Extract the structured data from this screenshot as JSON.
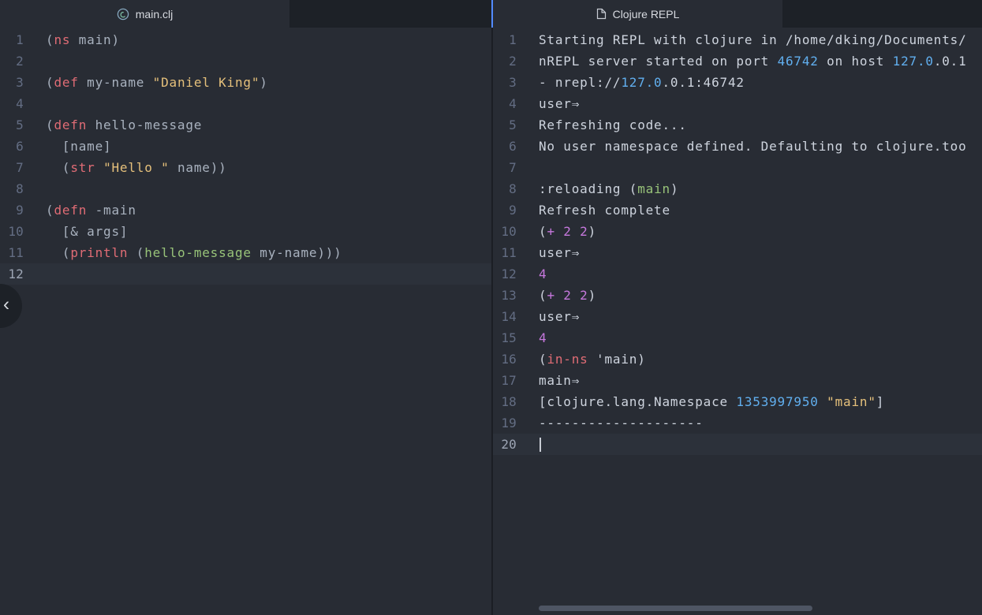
{
  "theme": {
    "accent": "#528bff",
    "editor_bg": "#282c34",
    "tabbar_bg": "#1d2127",
    "current_line": "#2c313a",
    "gutter": "#636d83",
    "gutter_active": "#9da5b4",
    "fg": "#a9b2bf",
    "out": "#ced4de",
    "kw": "#e06c75",
    "str": "#e5c07b",
    "fn": "#98c379",
    "num": "#61afef",
    "op": "#c678dd"
  },
  "icons": {
    "collapse_chevron": "‹",
    "left_tab_icon": "clojure-logo-icon",
    "right_tab_icon": "file-icon"
  },
  "left_editor": {
    "tab_label": "main.clj",
    "active_line": 12,
    "lines": [
      [
        [
          "(",
          "fg"
        ],
        [
          "ns",
          "kw"
        ],
        [
          " main)",
          "fg"
        ]
      ],
      [],
      [
        [
          "(",
          "fg"
        ],
        [
          "def",
          "kw"
        ],
        [
          " my-name ",
          "fg"
        ],
        [
          "\"Daniel King\"",
          "str"
        ],
        [
          ")",
          "fg"
        ]
      ],
      [],
      [
        [
          "(",
          "fg"
        ],
        [
          "defn",
          "kw"
        ],
        [
          " hello-message",
          "fg"
        ]
      ],
      [
        [
          "  [name]",
          "fg"
        ]
      ],
      [
        [
          "  (",
          "fg"
        ],
        [
          "str",
          "kw"
        ],
        [
          " ",
          "fg"
        ],
        [
          "\"Hello \"",
          "str"
        ],
        [
          " name))",
          "fg"
        ]
      ],
      [],
      [
        [
          "(",
          "fg"
        ],
        [
          "defn",
          "kw"
        ],
        [
          " -main",
          "fg"
        ]
      ],
      [
        [
          "  [& args]",
          "fg"
        ]
      ],
      [
        [
          "  (",
          "fg"
        ],
        [
          "println",
          "kw"
        ],
        [
          " (",
          "fg"
        ],
        [
          "hello-message",
          "fn"
        ],
        [
          " my-name)))",
          "fg"
        ]
      ],
      []
    ]
  },
  "right_editor": {
    "tab_label": "Clojure REPL",
    "active_line": 20,
    "cursor_line": 20,
    "lines": [
      [
        [
          "Starting REPL with clojure in /home/dking/Documents/",
          "out"
        ]
      ],
      [
        [
          "nREPL server started on port ",
          "out"
        ],
        [
          "46742",
          "num"
        ],
        [
          " on host ",
          "out"
        ],
        [
          "127.0",
          "num"
        ],
        [
          ".0.1",
          "out"
        ]
      ],
      [
        [
          "- nrepl://",
          "out"
        ],
        [
          "127.0",
          "num"
        ],
        [
          ".0.1:46742",
          "out"
        ]
      ],
      [
        [
          "user⇒",
          "out"
        ]
      ],
      [
        [
          "Refreshing code...",
          "out"
        ]
      ],
      [
        [
          "No user namespace defined. Defaulting to clojure.too",
          "out"
        ]
      ],
      [],
      [
        [
          ":reloading (",
          "out"
        ],
        [
          "main",
          "fn"
        ],
        [
          ")",
          "out"
        ]
      ],
      [
        [
          "Refresh complete",
          "out"
        ]
      ],
      [
        [
          "(",
          "out"
        ],
        [
          "+ 2 2",
          "op"
        ],
        [
          ")",
          "out"
        ]
      ],
      [
        [
          "user⇒",
          "out"
        ]
      ],
      [
        [
          "4",
          "op"
        ]
      ],
      [
        [
          "(",
          "out"
        ],
        [
          "+ 2 2",
          "op"
        ],
        [
          ")",
          "out"
        ]
      ],
      [
        [
          "user⇒",
          "out"
        ]
      ],
      [
        [
          "4",
          "op"
        ]
      ],
      [
        [
          "(",
          "out"
        ],
        [
          "in-ns",
          "kw"
        ],
        [
          " 'main)",
          "out"
        ]
      ],
      [
        [
          "main⇒",
          "out"
        ]
      ],
      [
        [
          "[clojure.lang.Namespace ",
          "out"
        ],
        [
          "1353997950",
          "num"
        ],
        [
          " ",
          "out"
        ],
        [
          "\"main\"",
          "str"
        ],
        [
          "]",
          "out"
        ]
      ],
      [
        [
          "--------------------",
          "out"
        ]
      ],
      []
    ]
  }
}
